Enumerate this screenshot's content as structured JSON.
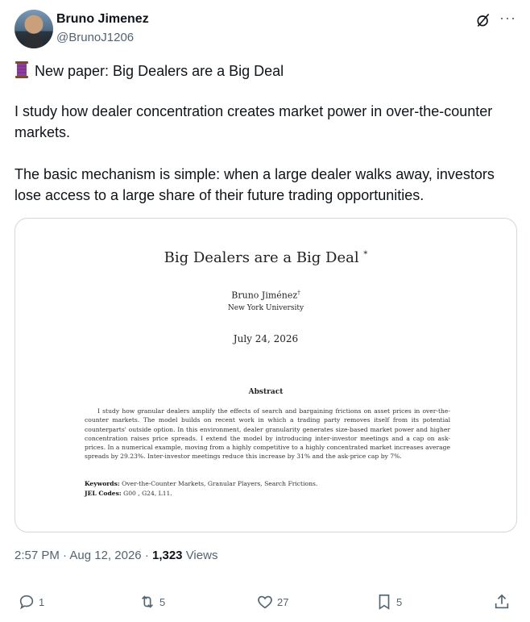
{
  "author": {
    "name": "Bruno Jimenez",
    "handle": "@BrunoJ1206"
  },
  "icons": {
    "grok": "grok-icon",
    "more": "more-icon",
    "thread": "spool-thread-icon"
  },
  "tweet": {
    "line1": "New paper: Big Dealers are a Big Deal",
    "para2_l1": "I study how dealer concentration creates market power in over-the-counter",
    "para2_l2": "markets.",
    "para3_l1": "The basic mechanism is simple: when a large dealer walks away, investors",
    "para3_l2": "lose access to a large share of their future trading opportunities."
  },
  "paper": {
    "title": "Big Dealers are a Big Deal",
    "title_mark": "*",
    "author": "Bruno Jiménez",
    "author_mark": "†",
    "affiliation": "New York University",
    "date": "July 24, 2026",
    "abstract_heading": "Abstract",
    "abstract": "I study how granular dealers amplify the effects of search and bargaining frictions on asset prices in over-the-counter markets. The model builds on recent work in which a trading party removes itself from its potential counterparts' outside option. In this environment, dealer granularity generates size-based market power and higher concentration raises price spreads. I extend the model by introducing inter-investor meetings and a cap on ask-prices. In a numerical example, moving from a highly competitive to a highly concentrated market increases average spreads by 29.23%. Inter-investor meetings reduce this increase by 31% and the ask-price cap by 7%.",
    "keywords_label": "Keywords:",
    "keywords": "Over-the-Counter Markets, Granular Players, Search Frictions.",
    "jel_label": "JEL Codes:",
    "jel": "G00 , G24, L11."
  },
  "meta": {
    "time": "2:57 PM",
    "sep": "·",
    "date": "Aug 12, 2026",
    "dot": "·",
    "views": "1,323",
    "views_label": "Views"
  },
  "actions": {
    "replies": "1",
    "reposts": "5",
    "likes": "27",
    "bookmarks": "5"
  }
}
